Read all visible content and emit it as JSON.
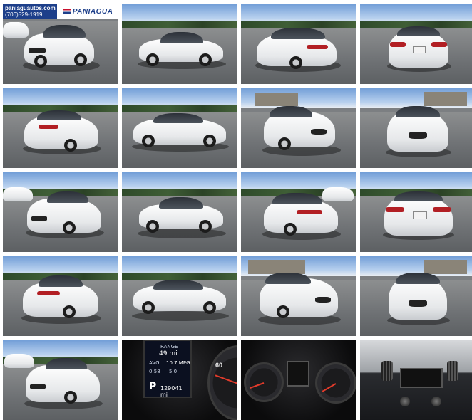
{
  "logo": {
    "website": "paniaguautos.com",
    "phone": "(706)529-1919",
    "brand": "PANIAGUA"
  },
  "gallery": {
    "total_photos": 20
  },
  "dash_readout": {
    "range_label": "RANGE",
    "range_value": "49 mi",
    "avg_label": "AVG",
    "avg_value": "10.7 MPG",
    "time_value": "0:58",
    "duration_value": "5.0",
    "gear": "P",
    "odometer": "129041 mi",
    "speedo_mark": "60"
  }
}
